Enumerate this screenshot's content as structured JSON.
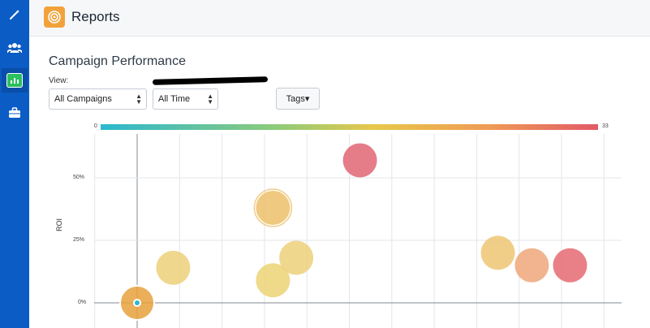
{
  "header": {
    "title": "Reports"
  },
  "sidebar": {
    "items": [
      {
        "name": "magic-wand-icon"
      },
      {
        "name": "users-icon"
      },
      {
        "name": "chart-icon",
        "active": true
      },
      {
        "name": "briefcase-icon"
      }
    ]
  },
  "main": {
    "title": "Campaign Performance",
    "view_label": "View:",
    "view_select": "All Campaigns",
    "time_select": "All Time",
    "tags_label": "Tags▾"
  },
  "colors": {
    "sidebar": "#0b5cc4",
    "accent_orange": "#f2a23a",
    "active_green": "#2bbf5f"
  },
  "chart_data": {
    "type": "scatter",
    "ylabel": "ROI",
    "color_scale": {
      "min_label": "0",
      "max_label": "33",
      "min": 0,
      "max": 33
    },
    "y_ticks": [
      "50%",
      "25%",
      "0%"
    ],
    "y_tick_values": [
      50,
      25,
      0
    ],
    "ylim": [
      -6,
      70
    ],
    "x_column_lines": 12,
    "points": [
      {
        "col": 0.0,
        "y": 0,
        "color": "#e8a13c",
        "selected": true
      },
      {
        "col": 0.85,
        "y": 14,
        "color": "#ecd07a"
      },
      {
        "col": 3.2,
        "y": 38,
        "color": "#ecc06a",
        "ring": true
      },
      {
        "col": 3.2,
        "y": 9,
        "color": "#ecd375"
      },
      {
        "col": 3.75,
        "y": 18,
        "color": "#ecd07a"
      },
      {
        "col": 5.25,
        "y": 57,
        "color": "#e06674"
      },
      {
        "col": 8.5,
        "y": 20,
        "color": "#efc672"
      },
      {
        "col": 9.3,
        "y": 15,
        "color": "#eea77a"
      },
      {
        "col": 10.2,
        "y": 15,
        "color": "#e56a73"
      }
    ]
  }
}
